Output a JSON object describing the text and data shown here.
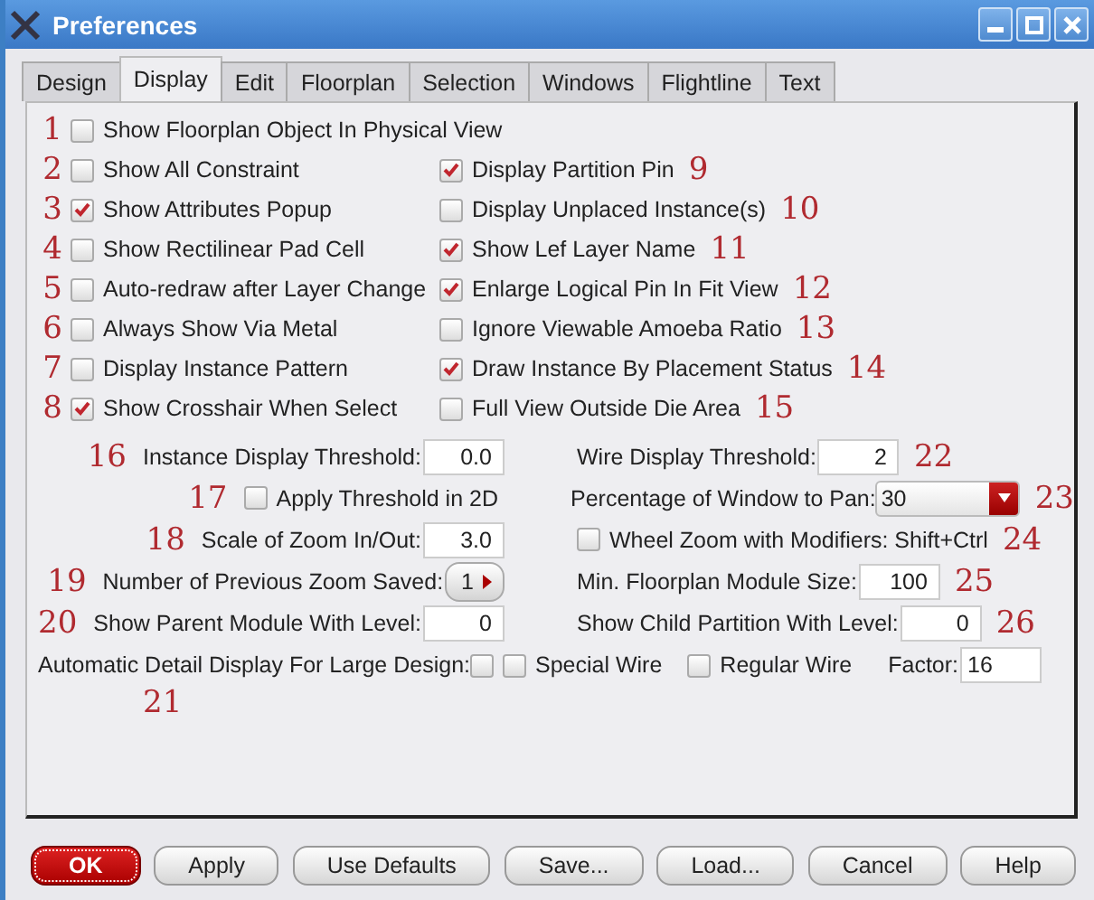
{
  "window": {
    "title": "Preferences"
  },
  "tabs": [
    {
      "label": "Design",
      "selected": false
    },
    {
      "label": "Display",
      "selected": true
    },
    {
      "label": "Edit",
      "selected": false
    },
    {
      "label": "Floorplan",
      "selected": false
    },
    {
      "label": "Selection",
      "selected": false
    },
    {
      "label": "Windows",
      "selected": false
    },
    {
      "label": "Flightline",
      "selected": false
    },
    {
      "label": "Text",
      "selected": false
    }
  ],
  "wide_option": {
    "marker": "1",
    "label": "Show Floorplan Object In Physical View",
    "checked": false
  },
  "option_rows": [
    {
      "left": {
        "marker": "2",
        "label": "Show All Constraint",
        "checked": false
      },
      "right": {
        "marker": "9",
        "label": "Display Partition Pin",
        "checked": true
      }
    },
    {
      "left": {
        "marker": "3",
        "label": "Show Attributes Popup",
        "checked": true
      },
      "right": {
        "marker": "10",
        "label": "Display Unplaced Instance(s)",
        "checked": false
      }
    },
    {
      "left": {
        "marker": "4",
        "label": "Show Rectilinear Pad Cell",
        "checked": false
      },
      "right": {
        "marker": "11",
        "label": "Show Lef Layer Name",
        "checked": true
      }
    },
    {
      "left": {
        "marker": "5",
        "label": "Auto-redraw after Layer Change",
        "checked": false
      },
      "right": {
        "marker": "12",
        "label": "Enlarge Logical Pin In Fit View",
        "checked": true
      }
    },
    {
      "left": {
        "marker": "6",
        "label": "Always Show Via Metal",
        "checked": false
      },
      "right": {
        "marker": "13",
        "label": "Ignore Viewable Amoeba Ratio",
        "checked": false
      }
    },
    {
      "left": {
        "marker": "7",
        "label": "Display Instance Pattern",
        "checked": false
      },
      "right": {
        "marker": "14",
        "label": "Draw Instance By Placement Status",
        "checked": true
      }
    },
    {
      "left": {
        "marker": "8",
        "label": "Show Crosshair When Select",
        "checked": true
      },
      "right": {
        "marker": "15",
        "label": "Full View Outside Die Area",
        "checked": false
      }
    }
  ],
  "setting_rows": [
    {
      "left": {
        "kind": "field",
        "marker": "16",
        "label": "Instance Display Threshold:",
        "value": "0.0"
      },
      "right": {
        "kind": "field",
        "marker": "22",
        "label": "Wire Display Threshold:",
        "value": "2"
      }
    },
    {
      "left": {
        "kind": "checkbox",
        "marker": "17",
        "label": "Apply Threshold in 2D",
        "checked": false
      },
      "right": {
        "kind": "dropdown",
        "marker": "23",
        "label": "Percentage of Window to Pan:",
        "value": "30"
      }
    },
    {
      "left": {
        "kind": "field",
        "marker": "18",
        "label": "Scale of Zoom In/Out:",
        "value": "3.0"
      },
      "right": {
        "kind": "checkbox",
        "marker": "24",
        "label": "Wheel Zoom with Modifiers: Shift+Ctrl",
        "checked": false
      }
    },
    {
      "left": {
        "kind": "spin",
        "marker": "19",
        "label": "Number of Previous Zoom Saved:",
        "value": "1"
      },
      "right": {
        "kind": "field",
        "marker": "25",
        "label": "Min. Floorplan Module Size:",
        "value": "100"
      }
    },
    {
      "left": {
        "kind": "field",
        "marker": "20",
        "label": "Show Parent Module With Level:",
        "value": "0"
      },
      "right": {
        "kind": "field",
        "marker": "26",
        "label": "Show Child Partition With Level:",
        "value": "0"
      }
    }
  ],
  "detail_row": {
    "label": "Automatic Detail Display For Large Design:",
    "checked": false,
    "options": [
      {
        "label": "Special Wire",
        "checked": false
      },
      {
        "label": "Regular Wire",
        "checked": false
      }
    ],
    "factor_label": "Factor:",
    "factor_value": "16",
    "marker": "21"
  },
  "buttons": [
    {
      "label": "OK",
      "kind": "default"
    },
    {
      "label": "Apply",
      "kind": "normal"
    },
    {
      "label": "Use Defaults",
      "kind": "normal"
    },
    {
      "label": "Save...",
      "kind": "normal"
    },
    {
      "label": "Load...",
      "kind": "normal"
    },
    {
      "label": "Cancel",
      "kind": "normal"
    },
    {
      "label": "Help",
      "kind": "normal"
    }
  ]
}
